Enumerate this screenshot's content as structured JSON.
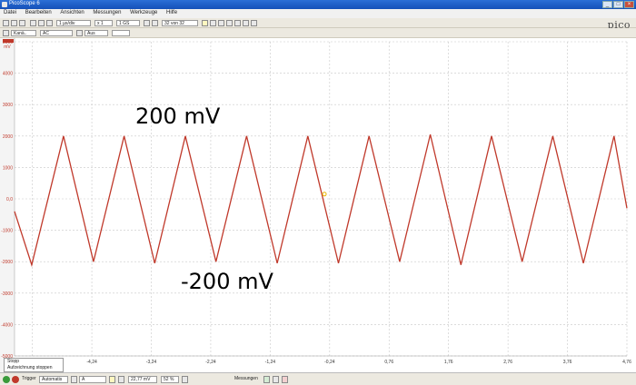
{
  "window": {
    "title": "PicoScope 6"
  },
  "menu": [
    "Datei",
    "Bearbeiten",
    "Ansichten",
    "Messungen",
    "Werkzeuge",
    "Hilfe"
  ],
  "toolbar": {
    "timebase": "1 µs/div",
    "multiplier": "x 1",
    "samples": "1 GS",
    "capture": "32 von 32",
    "logo": "pico"
  },
  "channel": {
    "name": "Kanä..",
    "coupling": "AC",
    "aux": "Aus"
  },
  "chart_data": {
    "type": "line",
    "y_ticks": [
      "5000",
      "4000",
      "3000",
      "2000",
      "1000",
      "0,0",
      "-1000",
      "-2000",
      "-3000",
      "-4000",
      "-5000"
    ],
    "y_unit": "mV",
    "ylim": [
      -5000,
      5000
    ],
    "x_ticks": [
      "-5,24",
      "-4,24",
      "-3,24",
      "-2,24",
      "-1,24",
      "-0,24",
      "0,76",
      "1,76",
      "2,76",
      "3,76",
      "4,76"
    ],
    "xlim": [
      -5.24,
      4.76
    ],
    "grid": true,
    "color": "#c0392b",
    "series": [
      {
        "x": [
          -5.24,
          -4.96,
          -4.44,
          -3.95,
          -3.45,
          -2.95,
          -2.45,
          -1.95,
          -1.45,
          -0.95,
          -0.45,
          0.05,
          0.55,
          1.05,
          1.55,
          2.05,
          2.55,
          3.05,
          3.55,
          4.05,
          4.55,
          4.76
        ],
        "y": [
          -400,
          -2100,
          2000,
          -2000,
          2000,
          -2050,
          2000,
          -2000,
          2000,
          -2050,
          2000,
          -2050,
          2000,
          -2000,
          2050,
          -2100,
          2000,
          -2000,
          2000,
          -2050,
          2000,
          -300
        ]
      }
    ],
    "trigger_marker": {
      "x": -0.18,
      "y": 150
    }
  },
  "annotations": {
    "top": "200 mV",
    "bottom": "-200 mV"
  },
  "status": {
    "popup_items": [
      "Stopp",
      "Aufzeichnung stoppen"
    ],
    "trigger_label": "Trigger",
    "trigger_mode": "Automatis",
    "trigger_channel": "A",
    "level": "22,77 mV",
    "pretrigger": "52 %",
    "measurements_label": "Messungen"
  }
}
